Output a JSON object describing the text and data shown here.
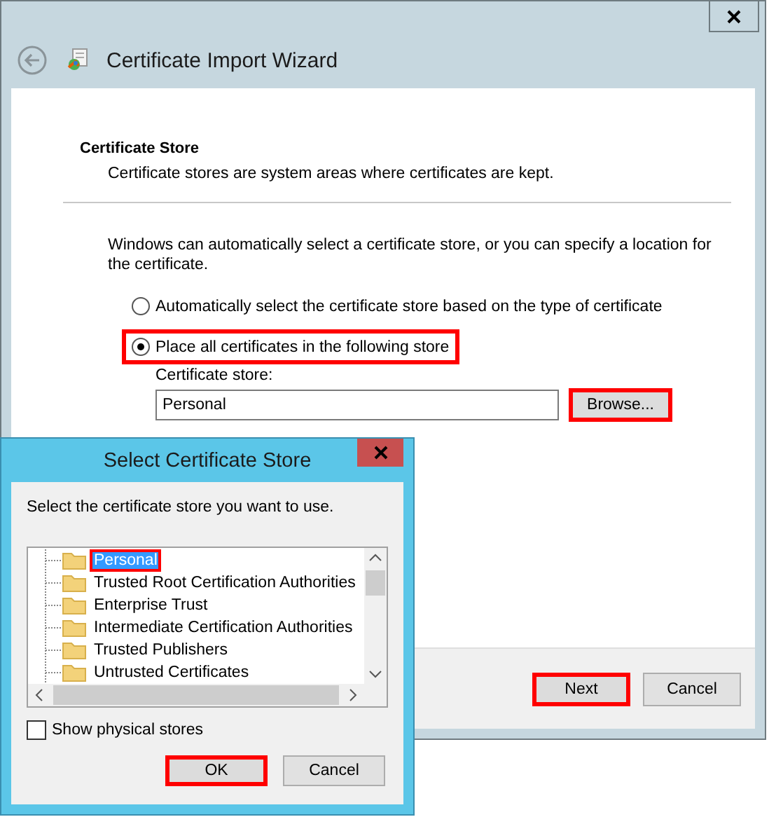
{
  "wizard": {
    "title": "Certificate Import Wizard",
    "section_title": "Certificate Store",
    "section_description": "Certificate stores are system areas where certificates are kept.",
    "instructions": "Windows can automatically select a certificate store, or you can specify a location for the certificate.",
    "options": [
      {
        "label": "Automatically select the certificate store based on the type of certificate",
        "selected": false,
        "highlighted": false
      },
      {
        "label": "Place all certificates in the following store",
        "selected": true,
        "highlighted": true
      }
    ],
    "store_label": "Certificate store:",
    "store_value": "Personal",
    "browse_button": {
      "label": "Browse...",
      "highlighted": true
    },
    "buttons": [
      {
        "label": "Next",
        "highlighted": true
      },
      {
        "label": "Cancel",
        "highlighted": false
      }
    ]
  },
  "dialog": {
    "title": "Select Certificate Store",
    "prompt": "Select the certificate store you want to use.",
    "stores": [
      {
        "label": "Personal",
        "selected": true,
        "highlighted": true
      },
      {
        "label": "Trusted Root Certification Authorities",
        "selected": false,
        "highlighted": false
      },
      {
        "label": "Enterprise Trust",
        "selected": false,
        "highlighted": false
      },
      {
        "label": "Intermediate Certification Authorities",
        "selected": false,
        "highlighted": false
      },
      {
        "label": "Trusted Publishers",
        "selected": false,
        "highlighted": false
      },
      {
        "label": "Untrusted Certificates",
        "selected": false,
        "highlighted": false
      }
    ],
    "show_physical_stores": {
      "label": "Show physical stores",
      "checked": false
    },
    "buttons": [
      {
        "label": "OK",
        "highlighted": true
      },
      {
        "label": "Cancel",
        "highlighted": false
      }
    ]
  }
}
